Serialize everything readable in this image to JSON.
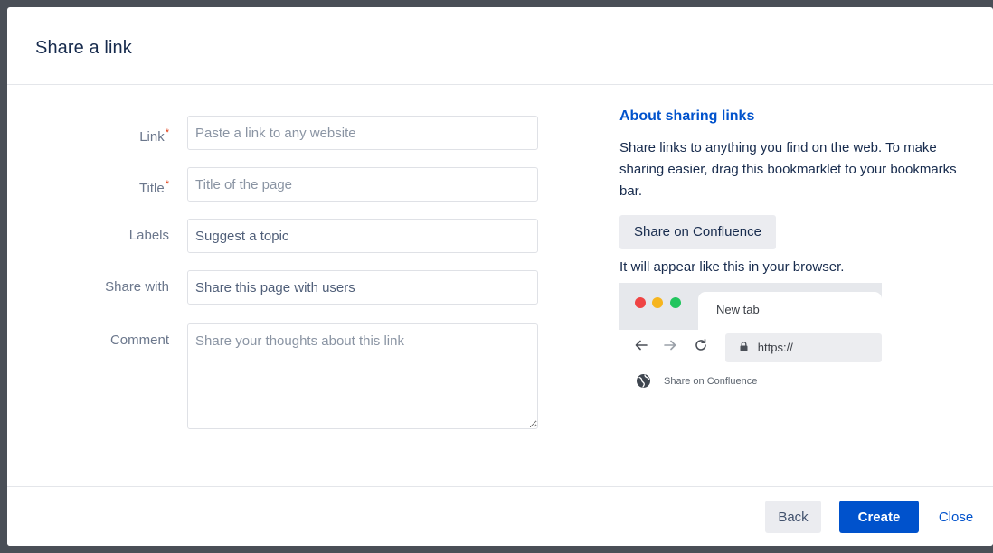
{
  "dialog": {
    "title": "Share a link"
  },
  "form": {
    "link": {
      "label": "Link",
      "required_mark": "*",
      "placeholder": "Paste a link to any website",
      "value": ""
    },
    "title": {
      "label": "Title",
      "required_mark": "*",
      "placeholder": "Title of the page",
      "value": ""
    },
    "labels": {
      "label": "Labels",
      "placeholder": "Suggest a topic",
      "value": ""
    },
    "share_with": {
      "label": "Share with",
      "placeholder": "Share this page with users",
      "value": ""
    },
    "comment": {
      "label": "Comment",
      "placeholder": "Share your thoughts about this link",
      "value": ""
    }
  },
  "about": {
    "title": "About sharing links",
    "description": "Share links to anything you find on the web. To make sharing easier, drag this bookmarklet to your bookmarks bar.",
    "bookmarklet_label": "Share on Confluence",
    "appear_text": "It will appear like this in your browser.",
    "browser_preview": {
      "tab_label": "New tab",
      "url": "https://",
      "bookmark_label": "Share on Confluence",
      "nav_icons": [
        "arrow-left-icon",
        "arrow-right-icon",
        "reload-icon",
        "lock-icon",
        "globe-icon"
      ]
    }
  },
  "footer": {
    "back_label": "Back",
    "create_label": "Create",
    "close_label": "Close"
  },
  "colors": {
    "primary": "#0052cc",
    "required": "#de350b",
    "dot_red": "#ef4444",
    "dot_yellow": "#f6b51e",
    "dot_green": "#22c55e"
  }
}
